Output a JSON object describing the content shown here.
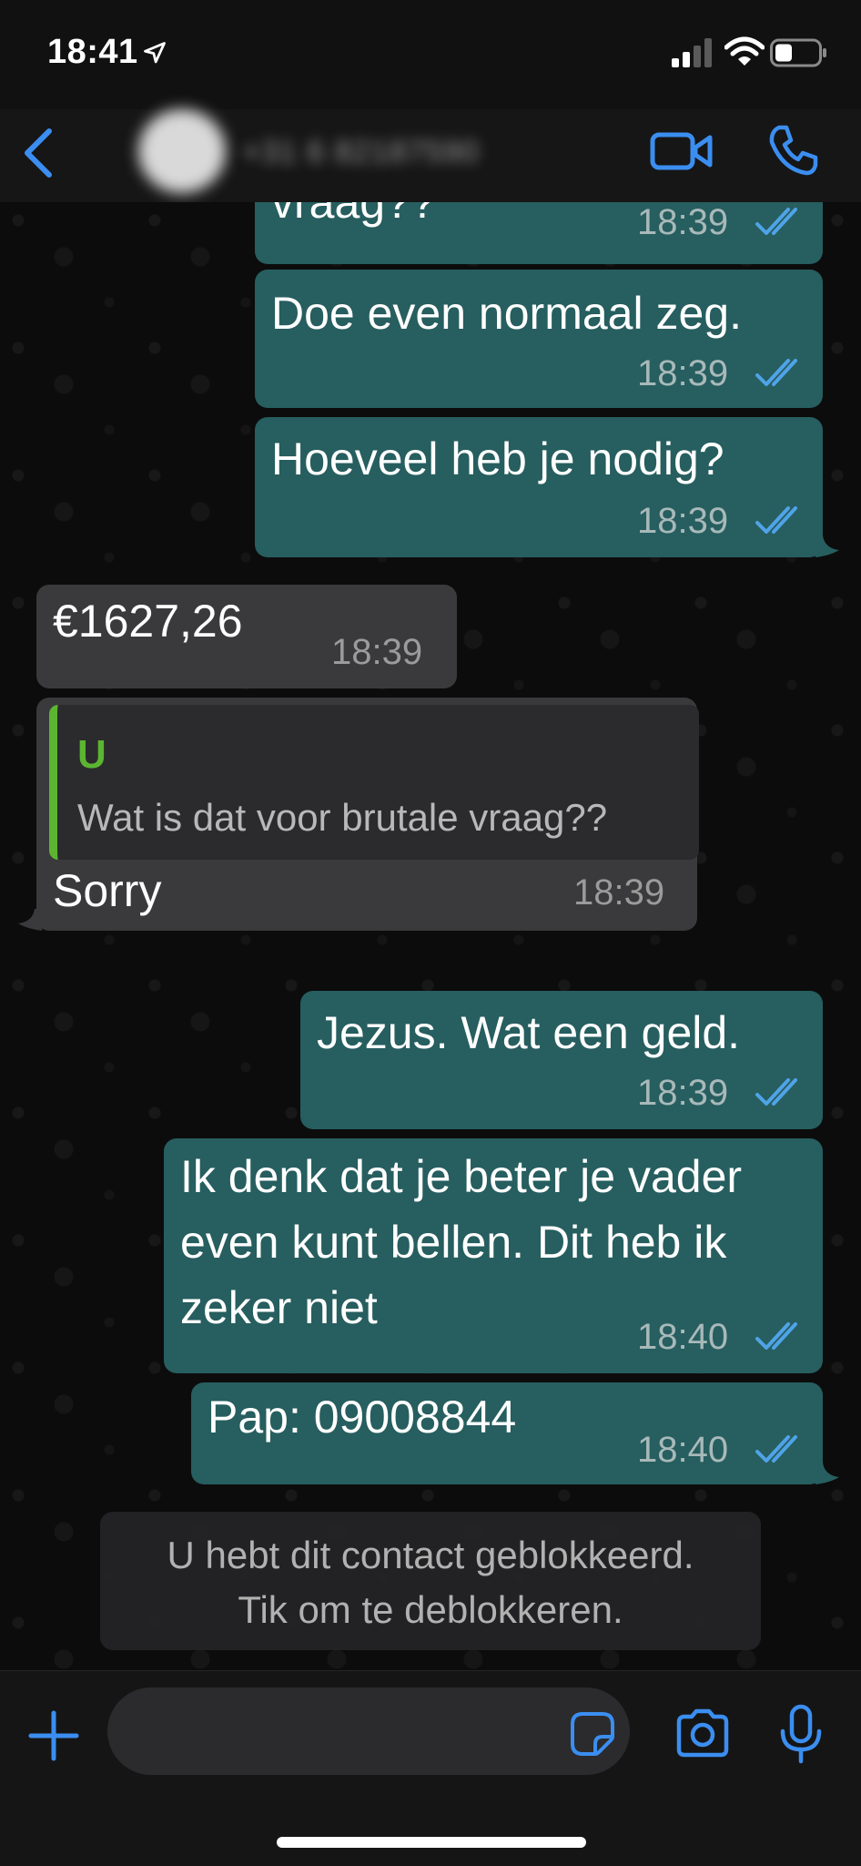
{
  "status_bar": {
    "time": "18:41"
  },
  "header": {
    "contact_name": "+31 6 82187590",
    "icons": [
      "back-chevron-icon",
      "video-call-icon",
      "voice-call-icon"
    ]
  },
  "messages": [
    {
      "direction": "outgoing",
      "text": "vraag??",
      "time": "18:39",
      "status": "read"
    },
    {
      "direction": "outgoing",
      "text": "Doe even normaal zeg.",
      "time": "18:39",
      "status": "read"
    },
    {
      "direction": "outgoing",
      "text": "Hoeveel heb je nodig?",
      "time": "18:39",
      "status": "read"
    },
    {
      "direction": "incoming",
      "text": "€1627,26",
      "time": "18:39"
    },
    {
      "direction": "incoming",
      "text": "Sorry",
      "time": "18:39",
      "quote": {
        "author": "U",
        "text": "Wat is dat voor brutale vraag??"
      }
    },
    {
      "direction": "outgoing",
      "text": "Jezus. Wat een geld.",
      "time": "18:39",
      "status": "read"
    },
    {
      "direction": "outgoing",
      "lines": [
        "Ik denk dat je beter je vader",
        "even kunt bellen. Dit heb ik",
        "zeker niet"
      ],
      "time": "18:40",
      "status": "read"
    },
    {
      "direction": "outgoing",
      "text": "Pap: 09008844",
      "time": "18:40",
      "status": "read"
    }
  ],
  "blocked_notice": {
    "line1": "U hebt dit contact geblokkeerd.",
    "line2": "Tik om te deblokkeren."
  },
  "input_bar": {
    "placeholder": "",
    "icons": [
      "plus-icon",
      "sticker-icon",
      "camera-icon",
      "microphone-icon"
    ]
  },
  "colors": {
    "accent": "#3b8ef0",
    "outgoing_bubble": "#275e5f",
    "incoming_bubble": "#3a3a3c",
    "quote_author": "#5cb531",
    "read_ticks": "#4fa3e8"
  }
}
